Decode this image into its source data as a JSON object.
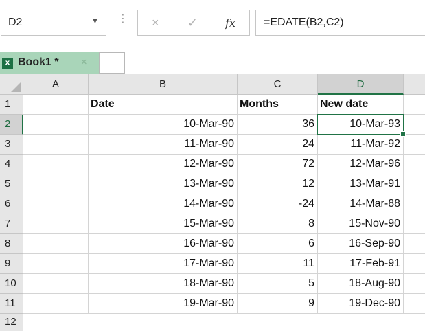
{
  "formula_bar": {
    "name_box": "D2",
    "cancel_icon": "×",
    "enter_icon": "✓",
    "fx_label": "fx",
    "formula": "=EDATE(B2,C2)"
  },
  "workbook_tab": {
    "title": "Book1 *",
    "close_icon": "×",
    "icon_letter": "x",
    "color": "#a9d5b9"
  },
  "grid": {
    "columns": [
      "A",
      "B",
      "C",
      "D"
    ],
    "rows": [
      "1",
      "2",
      "3",
      "4",
      "5",
      "6",
      "7",
      "8",
      "9",
      "10",
      "11"
    ],
    "partial_row": "12",
    "active_cell": "D2",
    "accent_color": "#217346",
    "headers": {
      "B": "Date",
      "C": "Months",
      "D": "New date"
    },
    "data": [
      {
        "date": "10-Mar-90",
        "months": "36",
        "new_date": "10-Mar-93"
      },
      {
        "date": "11-Mar-90",
        "months": "24",
        "new_date": "11-Mar-92"
      },
      {
        "date": "12-Mar-90",
        "months": "72",
        "new_date": "12-Mar-96"
      },
      {
        "date": "13-Mar-90",
        "months": "12",
        "new_date": "13-Mar-91"
      },
      {
        "date": "14-Mar-90",
        "months": "-24",
        "new_date": "14-Mar-88"
      },
      {
        "date": "15-Mar-90",
        "months": "8",
        "new_date": "15-Nov-90"
      },
      {
        "date": "16-Mar-90",
        "months": "6",
        "new_date": "16-Sep-90"
      },
      {
        "date": "17-Mar-90",
        "months": "11",
        "new_date": "17-Feb-91"
      },
      {
        "date": "18-Mar-90",
        "months": "5",
        "new_date": "18-Aug-90"
      },
      {
        "date": "19-Mar-90",
        "months": "9",
        "new_date": "19-Dec-90"
      }
    ]
  }
}
